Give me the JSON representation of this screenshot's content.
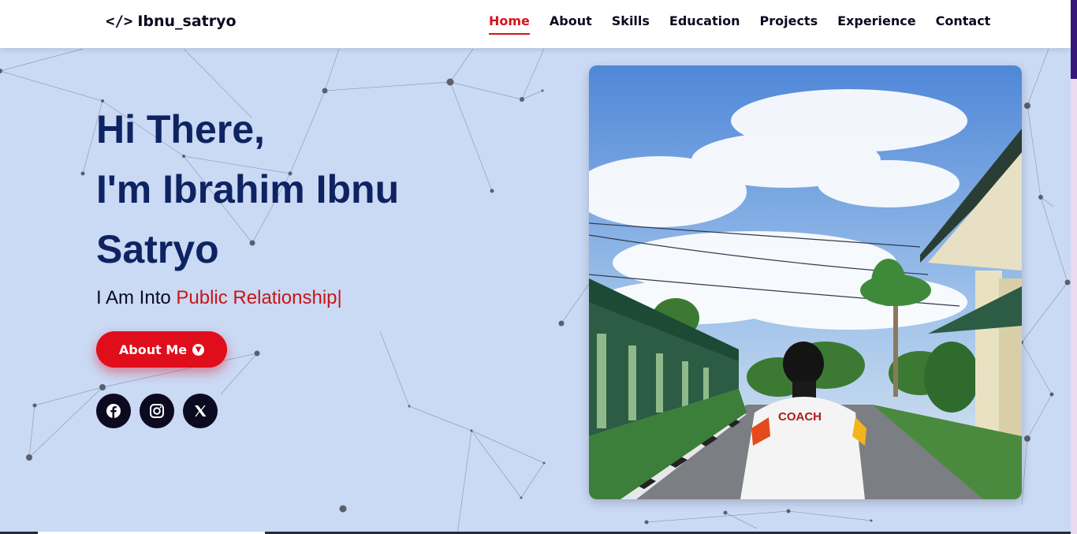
{
  "brand": {
    "icon": "code-icon",
    "name": "Ibnu_satryo"
  },
  "nav": {
    "items": [
      "Home",
      "About",
      "Skills",
      "Education",
      "Projects",
      "Experience",
      "Contact"
    ],
    "active": "Home"
  },
  "hero": {
    "line1": "Hi There,",
    "line2": "I'm Ibrahim Ibnu",
    "line3": "Satryo",
    "tagline_prefix": "I Am Into ",
    "tagline_role": "Public Relationship|",
    "button_label": "About Me",
    "button_icon": "arrow-down-circle-icon"
  },
  "socials": [
    "facebook-icon",
    "instagram-icon",
    "x-twitter-icon"
  ],
  "photo": {
    "jacket_text": "COACH"
  },
  "colors": {
    "background": "#cad9f4",
    "accent": "#e00d1b",
    "title": "#0e2361",
    "dark": "#0b0a1f"
  }
}
